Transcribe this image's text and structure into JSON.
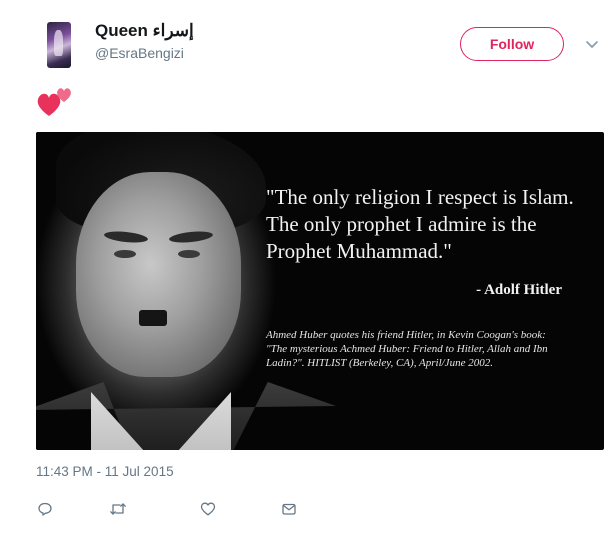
{
  "tweet": {
    "display_name": "Queen إسراء",
    "handle": "@EsraBengizi",
    "follow_label": "Follow",
    "emoji": "💕",
    "timestamp": "11:43 PM - 11 Jul 2015"
  },
  "image": {
    "quote": "\"The only religion I respect is Islam. The only prophet I admire is the Prophet Muhammad.\"",
    "attribution": "- Adolf Hitler",
    "citation": "Ahmed Huber quotes his friend Hitler, in Kevin Coogan's book: \"The mysterious Achmed Huber: Friend to Hitler, Allah and Ibn Ladin?\". HITLIST (Berkeley, CA), April/June 2002."
  },
  "icons": {
    "reply": "reply-icon",
    "retweet": "retweet-icon",
    "like": "heart-icon",
    "dm": "envelope-icon",
    "more": "chevron-down-icon"
  },
  "colors": {
    "accent": "#e0245e",
    "muted": "#657786",
    "text": "#14171a"
  }
}
